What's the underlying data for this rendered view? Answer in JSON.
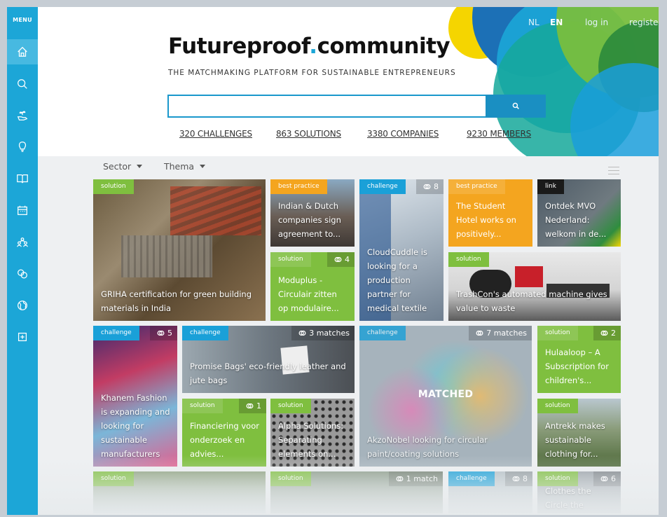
{
  "sidebar": {
    "menu_label": "MENU",
    "items": [
      {
        "icon": "home-icon",
        "active": true
      },
      {
        "icon": "search-icon"
      },
      {
        "icon": "hand-plant-icon"
      },
      {
        "icon": "lightbulb-icon"
      },
      {
        "icon": "book-icon"
      },
      {
        "icon": "calendar-icon"
      },
      {
        "icon": "people-icon"
      },
      {
        "icon": "link-icon"
      },
      {
        "icon": "globe-icon"
      },
      {
        "icon": "plus-square-icon"
      }
    ]
  },
  "header": {
    "lang_nl": "NL",
    "lang_en": "EN",
    "login": "log in",
    "register": "register",
    "logo_part1": "Futureproof",
    "logo_dot": ".",
    "logo_part2": "community",
    "tagline": "THE MATCHMAKING PLATFORM FOR SUSTAINABLE ENTREPRENEURS",
    "search_placeholder": "",
    "search_icon": "search-icon",
    "stats": [
      "320 CHALLENGES",
      "863 SOLUTIONS",
      "3380 COMPANIES",
      "9230 MEMBERS"
    ]
  },
  "filters": {
    "sector": "Sector",
    "thema": "Thema"
  },
  "colors": {
    "brand_blue": "#1ca6d7",
    "solution_green": "#7fbf3f",
    "challenge_blue": "#1aa0d8",
    "best_practice_orange": "#f4a51f",
    "link_black": "#1a1a1a"
  },
  "tiles": [
    {
      "tag": "solution",
      "title": "GRIHA certification for green building materials in India"
    },
    {
      "tag": "best practice",
      "title": "Indian & Dutch companies sign agreement to..."
    },
    {
      "tag": "challenge",
      "count": "8",
      "title": "CloudCuddle is looking for a production partner for medical textile"
    },
    {
      "tag": "best practice",
      "title": "The Student Hotel works on positively..."
    },
    {
      "tag": "link",
      "title": "Ontdek MVO Nederland: welkom in de..."
    },
    {
      "tag": "solution",
      "count": "4",
      "title": "Moduplus - Circulair zitten op modulaire..."
    },
    {
      "tag": "solution",
      "title": "TrashCon's automated machine gives value to waste"
    },
    {
      "tag": "challenge",
      "count": "5",
      "title": "Khanem Fashion is expanding and looking for sustainable manufacturers"
    },
    {
      "tag": "challenge",
      "count": "3 matches",
      "title": "Promise Bags' eco-friendly leather and jute bags"
    },
    {
      "tag": "challenge",
      "count": "7 matches",
      "title": "AkzoNobel looking for circular paint/coating solutions",
      "overlay": "MATCHED"
    },
    {
      "tag": "solution",
      "count": "2",
      "title": "Hulaaloop – A Subscription for children's..."
    },
    {
      "tag": "solution",
      "count": "1",
      "title": "Financiering voor onderzoek en advies..."
    },
    {
      "tag": "solution",
      "title": "Alpha Solutions: Separating elements on..."
    },
    {
      "tag": "solution",
      "title": "Antrekk makes sustainable clothing for..."
    },
    {
      "tag": "solution",
      "title": ""
    },
    {
      "tag": "solution",
      "count": "1 match",
      "title": ""
    },
    {
      "tag": "challenge",
      "count": "8",
      "title": ""
    },
    {
      "tag": "solution",
      "count": "6",
      "title": "Clothes the Circle the"
    }
  ]
}
